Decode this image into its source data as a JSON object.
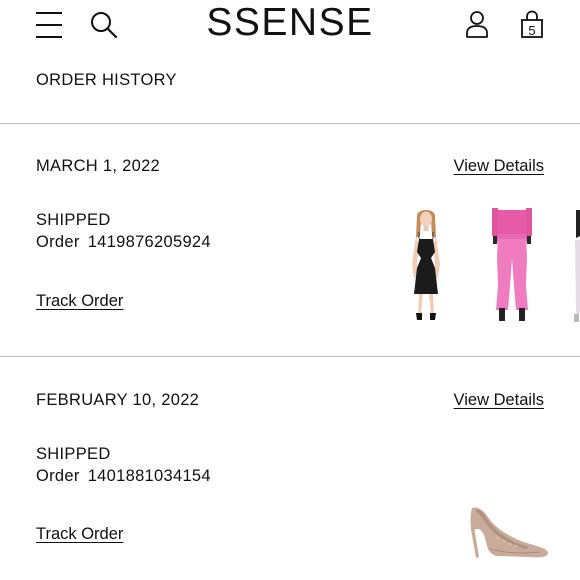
{
  "header": {
    "logo": "SSENSE",
    "bag_count": "5",
    "icons": [
      "menu-icon",
      "search-icon",
      "account-icon",
      "shopping-bag-icon"
    ]
  },
  "page": {
    "title": "ORDER HISTORY"
  },
  "orders": [
    {
      "date": "MARCH 1, 2022",
      "view_details_label": "View Details",
      "status": "SHIPPED",
      "order_label": "Order",
      "order_number": "1419876205924",
      "track_label": "Track Order",
      "items": [
        "black-mini-dress",
        "pink-flared-jeans",
        "partially-visible-item"
      ]
    },
    {
      "date": "FEBRUARY 10, 2022",
      "view_details_label": "View Details",
      "status": "SHIPPED",
      "order_label": "Order",
      "order_number": "1401881034154",
      "track_label": "Track Order",
      "items": [
        "studded-pump"
      ]
    }
  ]
}
